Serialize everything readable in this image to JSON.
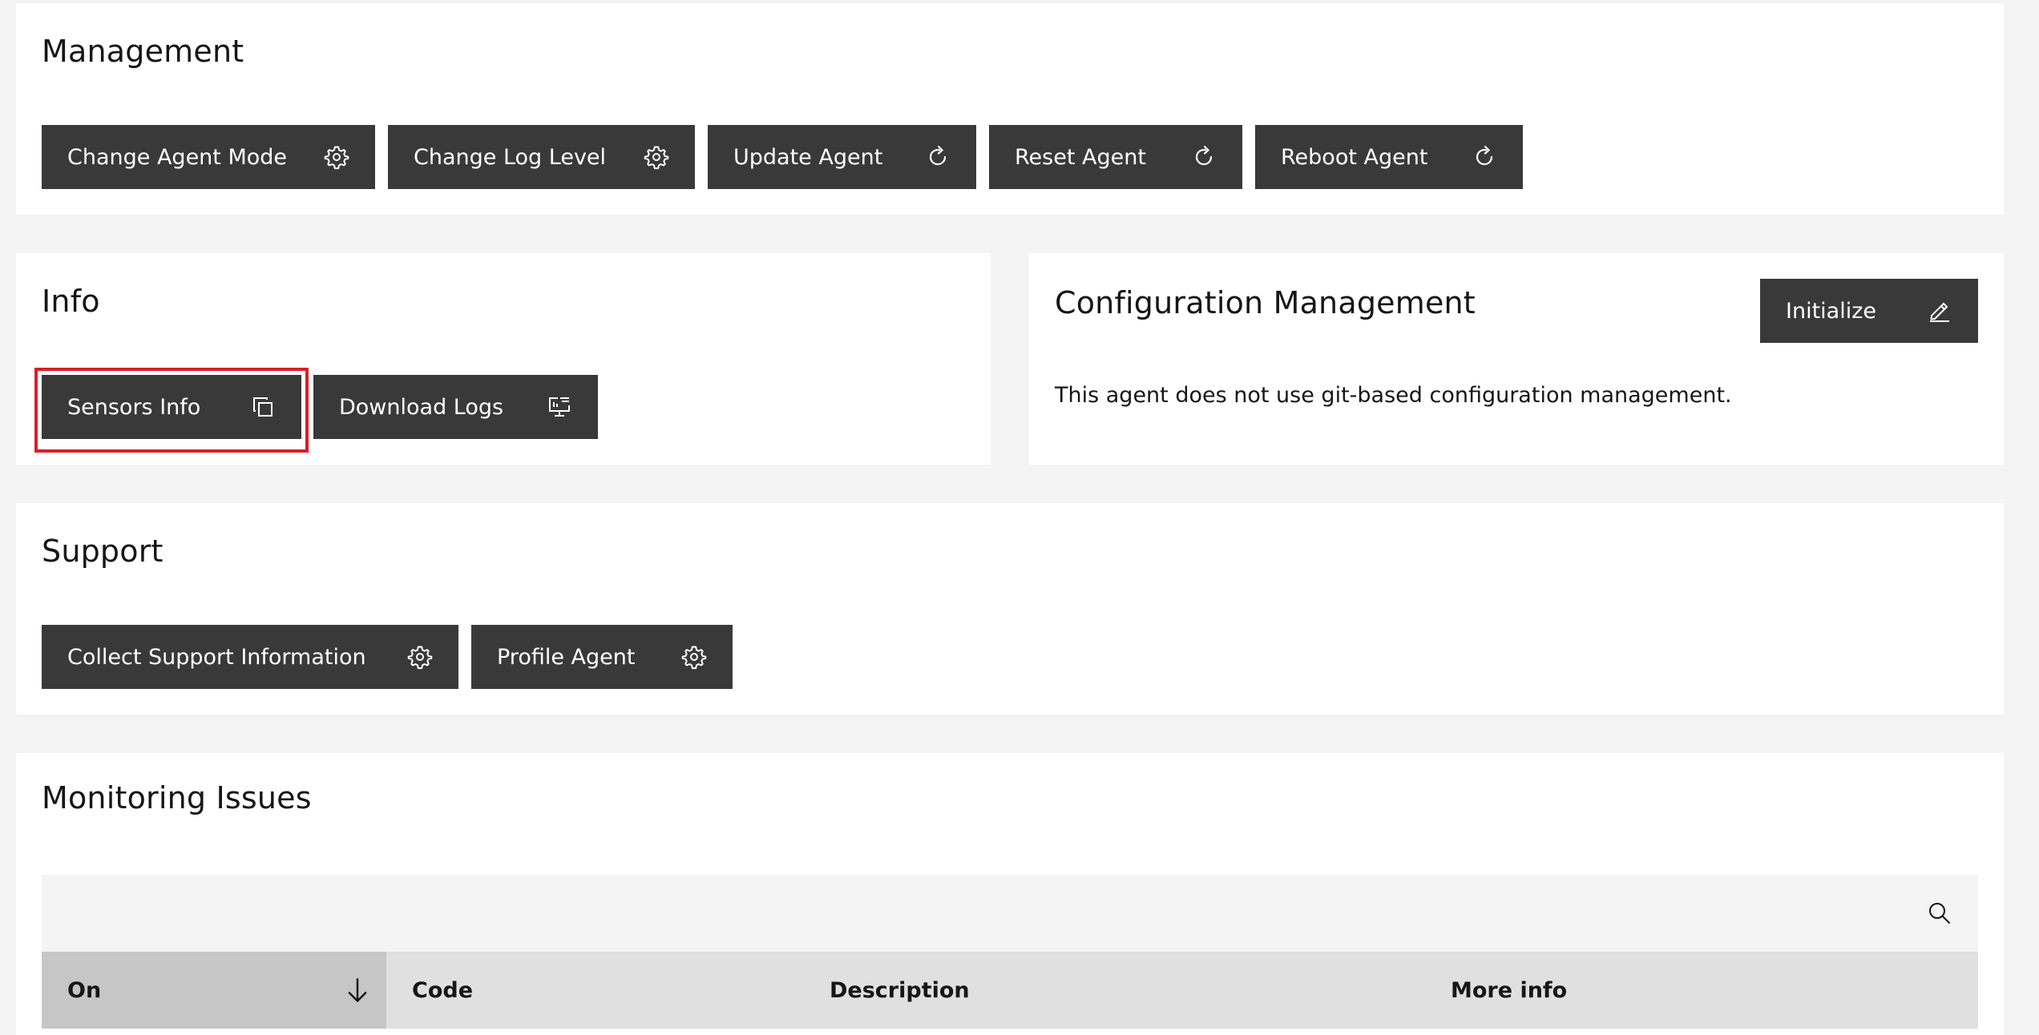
{
  "management": {
    "title": "Management",
    "buttons": {
      "change_agent_mode": "Change Agent Mode",
      "change_log_level": "Change Log Level",
      "update_agent": "Update Agent",
      "reset_agent": "Reset Agent",
      "reboot_agent": "Reboot Agent"
    }
  },
  "info": {
    "title": "Info",
    "buttons": {
      "sensors_info": "Sensors Info",
      "download_logs": "Download Logs"
    }
  },
  "configuration": {
    "title": "Configuration Management",
    "initialize_label": "Initialize",
    "message": "This agent does not use git-based configuration management."
  },
  "support": {
    "title": "Support",
    "buttons": {
      "collect_support_information": "Collect Support Information",
      "profile_agent": "Profile Agent"
    }
  },
  "monitoring_issues": {
    "title": "Monitoring Issues",
    "columns": {
      "on": "On",
      "code": "Code",
      "description": "Description",
      "more_info": "More info"
    },
    "sorted_column": "On",
    "sort_direction": "descending"
  },
  "icons": {
    "settings": "gear-icon",
    "restart": "restart-icon",
    "copy": "copy-icon",
    "download_logs": "monitor-log-icon",
    "edit": "pencil-icon",
    "search": "search-icon",
    "sort": "arrow-down-icon"
  },
  "colors": {
    "background": "#f4f4f4",
    "tile": "#ffffff",
    "button": "#393939",
    "button_text": "#ffffff",
    "focus_outline": "#da1e28",
    "table_header": "#e0e0e0",
    "table_header_sorted": "#c6c6c6"
  }
}
